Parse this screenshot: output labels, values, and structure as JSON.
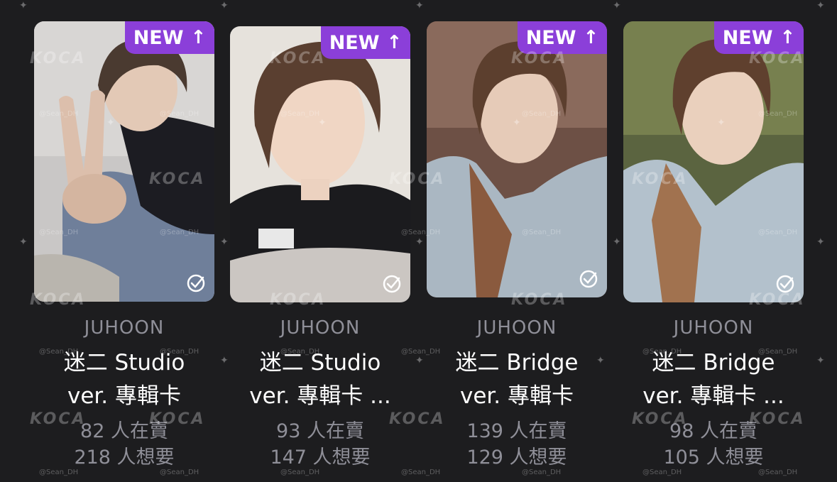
{
  "theme": {
    "background": "#1d1d1f",
    "badge_color": "#8b3fd9",
    "text_primary": "#ffffff",
    "text_secondary": "#8f8f98"
  },
  "cards": [
    {
      "badge": "NEW",
      "badge_icon": "arrow-up-icon",
      "member": "JUHOON",
      "title_line1": "迷二 Studio",
      "title_line2": "ver. 專輯卡",
      "sell": "82 人在賣",
      "want": "218 人想要"
    },
    {
      "badge": "NEW",
      "badge_icon": "arrow-up-icon",
      "member": "JUHOON",
      "title_line1": "迷二 Studio",
      "title_line2": "ver. 專輯卡 ...",
      "sell": "93 人在賣",
      "want": "147 人想要"
    },
    {
      "badge": "NEW",
      "badge_icon": "arrow-up-icon",
      "member": "JUHOON",
      "title_line1": "迷二 Bridge",
      "title_line2": "ver. 專輯卡",
      "sell": "139 人在賣",
      "want": "129 人想要"
    },
    {
      "badge": "NEW",
      "badge_icon": "arrow-up-icon",
      "member": "JUHOON",
      "title_line1": "迷二 Bridge",
      "title_line2": "ver. 專輯卡 ...",
      "sell": "98 人在賣",
      "want": "105 人想要"
    }
  ],
  "watermark": {
    "logo": "KOCA",
    "handle": "@Sean_DH"
  }
}
